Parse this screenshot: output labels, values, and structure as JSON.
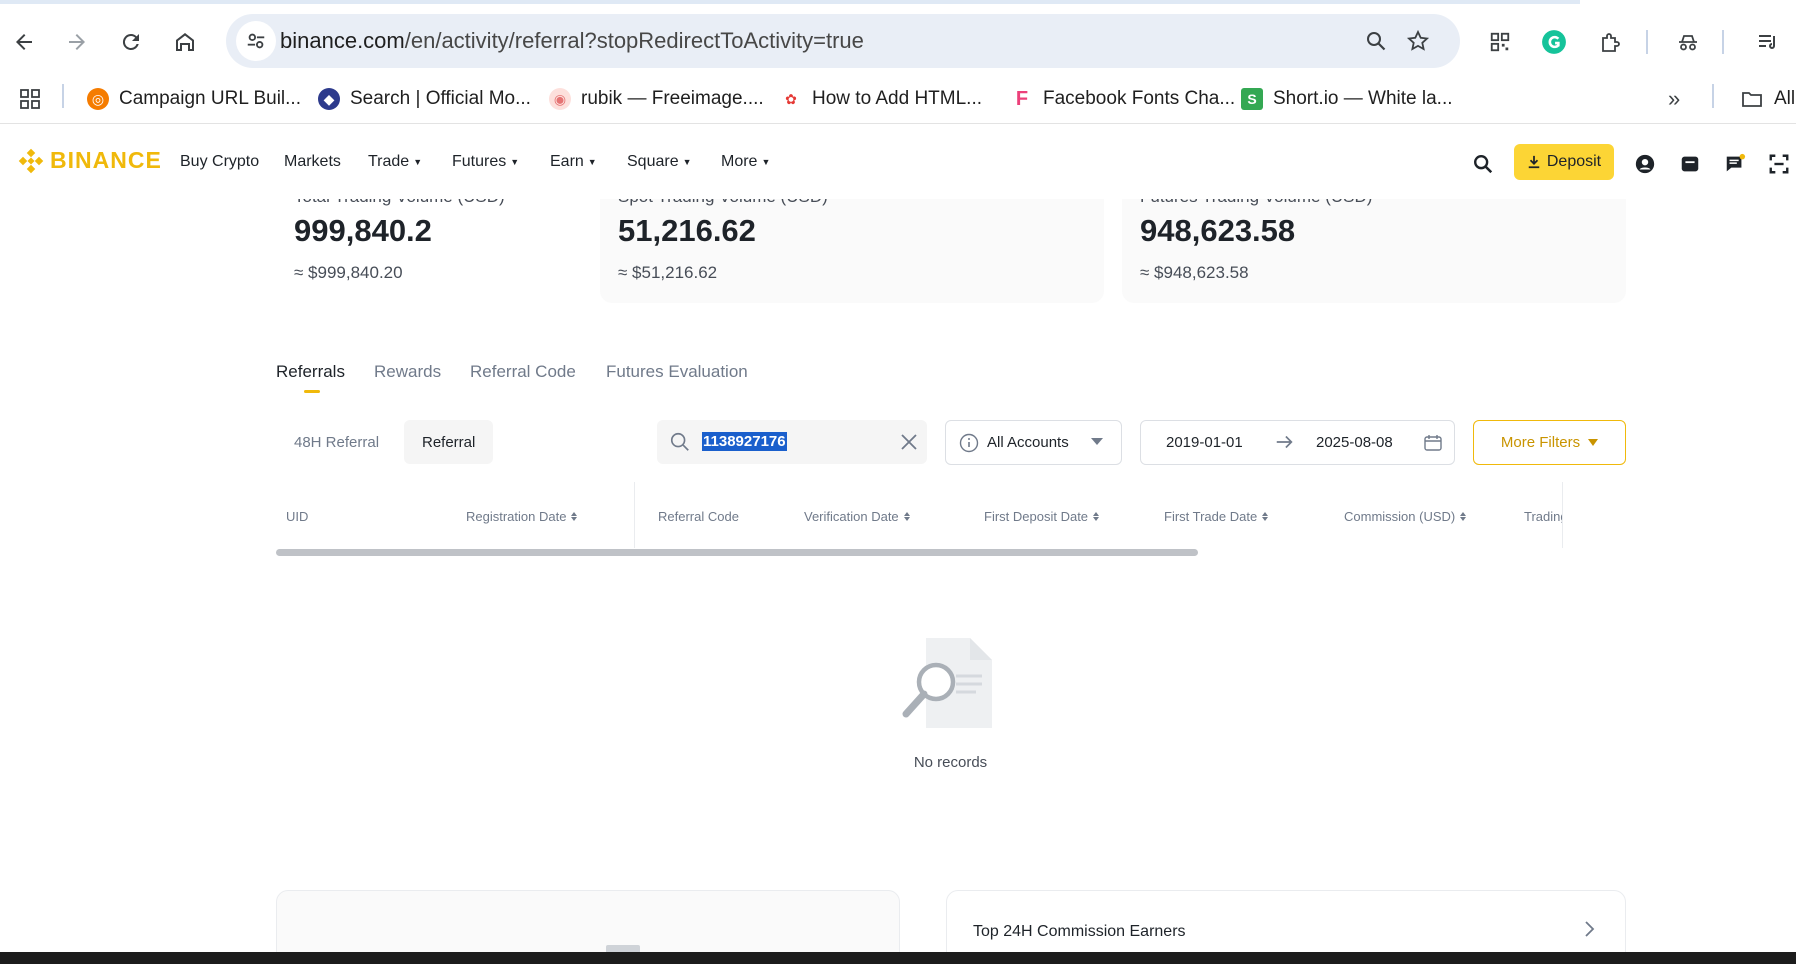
{
  "browser": {
    "url_domain": "binance.com",
    "url_path": "/en/activity/referral?stopRedirectToActivity=true",
    "bookmarks": [
      {
        "label": "Campaign URL Buil...",
        "icon": "ga-icon",
        "color": "#f57c00"
      },
      {
        "label": "Search | Official Mo...",
        "icon": "globe-icon",
        "color": "#2d3a8c"
      },
      {
        "label": "rubik — Freeimage....",
        "icon": "freeimage-icon",
        "color": "#e57373"
      },
      {
        "label": "How to Add HTML...",
        "icon": "html-icon",
        "color": "#e53935"
      },
      {
        "label": "Facebook Fonts Cha...",
        "icon": "f-icon",
        "color": "#ec407a"
      },
      {
        "label": "Short.io — White la...",
        "icon": "shortio-icon",
        "color": "#34a853"
      }
    ],
    "all_bookmarks_label": "All"
  },
  "header": {
    "logo_text": "BINANCE",
    "nav": [
      {
        "label": "Buy Crypto",
        "has_caret": false
      },
      {
        "label": "Markets",
        "has_caret": false
      },
      {
        "label": "Trade",
        "has_caret": true
      },
      {
        "label": "Futures",
        "has_caret": true
      },
      {
        "label": "Earn",
        "has_caret": true
      },
      {
        "label": "Square",
        "has_caret": true
      },
      {
        "label": "More",
        "has_caret": true
      }
    ],
    "deposit_label": "Deposit",
    "accent": "#fcd535"
  },
  "stats": [
    {
      "label": "Total Trading Volume (USD)",
      "value": "999,840.2",
      "sub": "≈ $999,840.20"
    },
    {
      "label": "Spot Trading Volume (USD)",
      "value": "51,216.62",
      "sub": "≈ $51,216.62"
    },
    {
      "label": "Futures Trading Volume (USD)",
      "value": "948,623.58",
      "sub": "≈ $948,623.58"
    }
  ],
  "tabs": [
    {
      "label": "Referrals",
      "active": true
    },
    {
      "label": "Rewards",
      "active": false
    },
    {
      "label": "Referral Code",
      "active": false
    },
    {
      "label": "Futures Evaluation",
      "active": false
    }
  ],
  "filters": {
    "segments": [
      {
        "label": "48H Referral",
        "active": false
      },
      {
        "label": "Referral",
        "active": true
      }
    ],
    "search_value": "1138927176",
    "account_select": "All Accounts",
    "date_from": "2019-01-01",
    "date_to": "2025-08-08",
    "more_filters_label": "More Filters"
  },
  "table": {
    "columns": [
      {
        "label": "UID",
        "sortable": false
      },
      {
        "label": "Registration Date",
        "sortable": true
      },
      {
        "label": "Referral Code",
        "sortable": false
      },
      {
        "label": "Verification Date",
        "sortable": true
      },
      {
        "label": "First Deposit Date",
        "sortable": true
      },
      {
        "label": "First Trade Date",
        "sortable": true
      },
      {
        "label": "Commission (USD)",
        "sortable": true
      },
      {
        "label": "Trading",
        "sortable": false
      }
    ],
    "empty_text": "No records"
  },
  "bottom": {
    "right_card_title": "Top 24H Commission Earners"
  }
}
